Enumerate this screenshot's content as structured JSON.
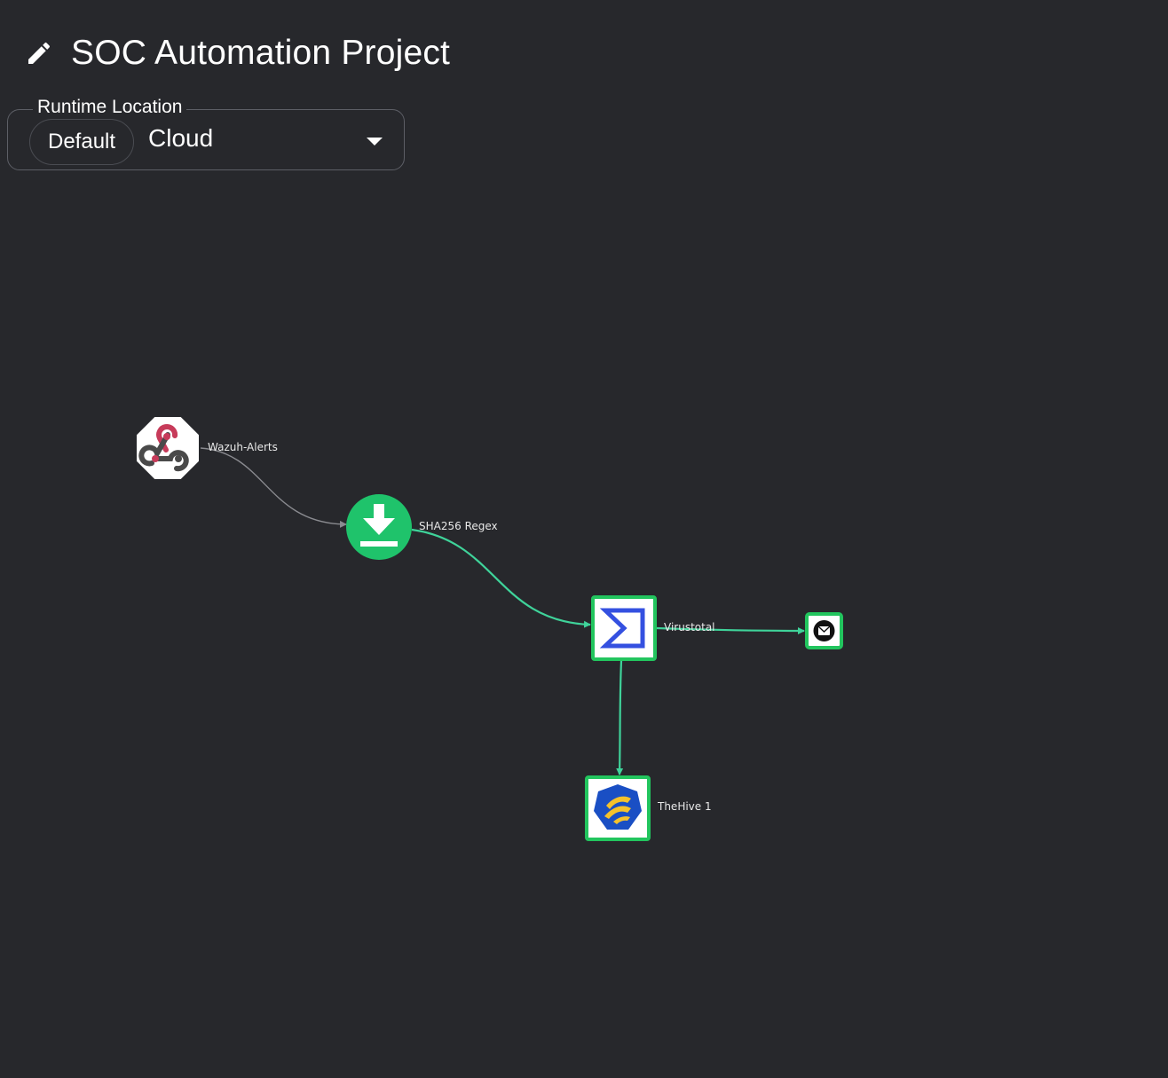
{
  "header": {
    "title": "SOC Automation Project",
    "edit_icon": "pencil-icon"
  },
  "runtime": {
    "legend": "Runtime Location",
    "chip_label": "Default",
    "value": "Cloud",
    "caret_icon": "caret-down-icon"
  },
  "workflow": {
    "nodes": [
      {
        "id": "webhook",
        "label": "Wazuh-Alerts",
        "icon": "webhook-icon"
      },
      {
        "id": "regex",
        "label": "SHA256 Regex",
        "icon": "download-icon"
      },
      {
        "id": "virustotal",
        "label": "Virustotal",
        "icon": "virustotal-sigma-icon"
      },
      {
        "id": "thehive",
        "label": "TheHive 1",
        "icon": "thehive-icon"
      },
      {
        "id": "email",
        "label": "",
        "icon": "email-icon"
      }
    ],
    "edges": [
      {
        "from": "webhook",
        "to": "regex"
      },
      {
        "from": "regex",
        "to": "virustotal"
      },
      {
        "from": "virustotal",
        "to": "email"
      },
      {
        "from": "virustotal",
        "to": "thehive"
      }
    ],
    "colors": {
      "background": "#27282c",
      "active_edge": "#3fd39a",
      "inactive_edge": "#8a8b90",
      "node_border": "#22c55e",
      "regex_fill": "#1fc36b",
      "webhook_red": "#c73b5a",
      "virustotal_blue": "#3450e0",
      "hive_blue": "#1a4fc4",
      "hive_yellow": "#f5c22c"
    }
  }
}
